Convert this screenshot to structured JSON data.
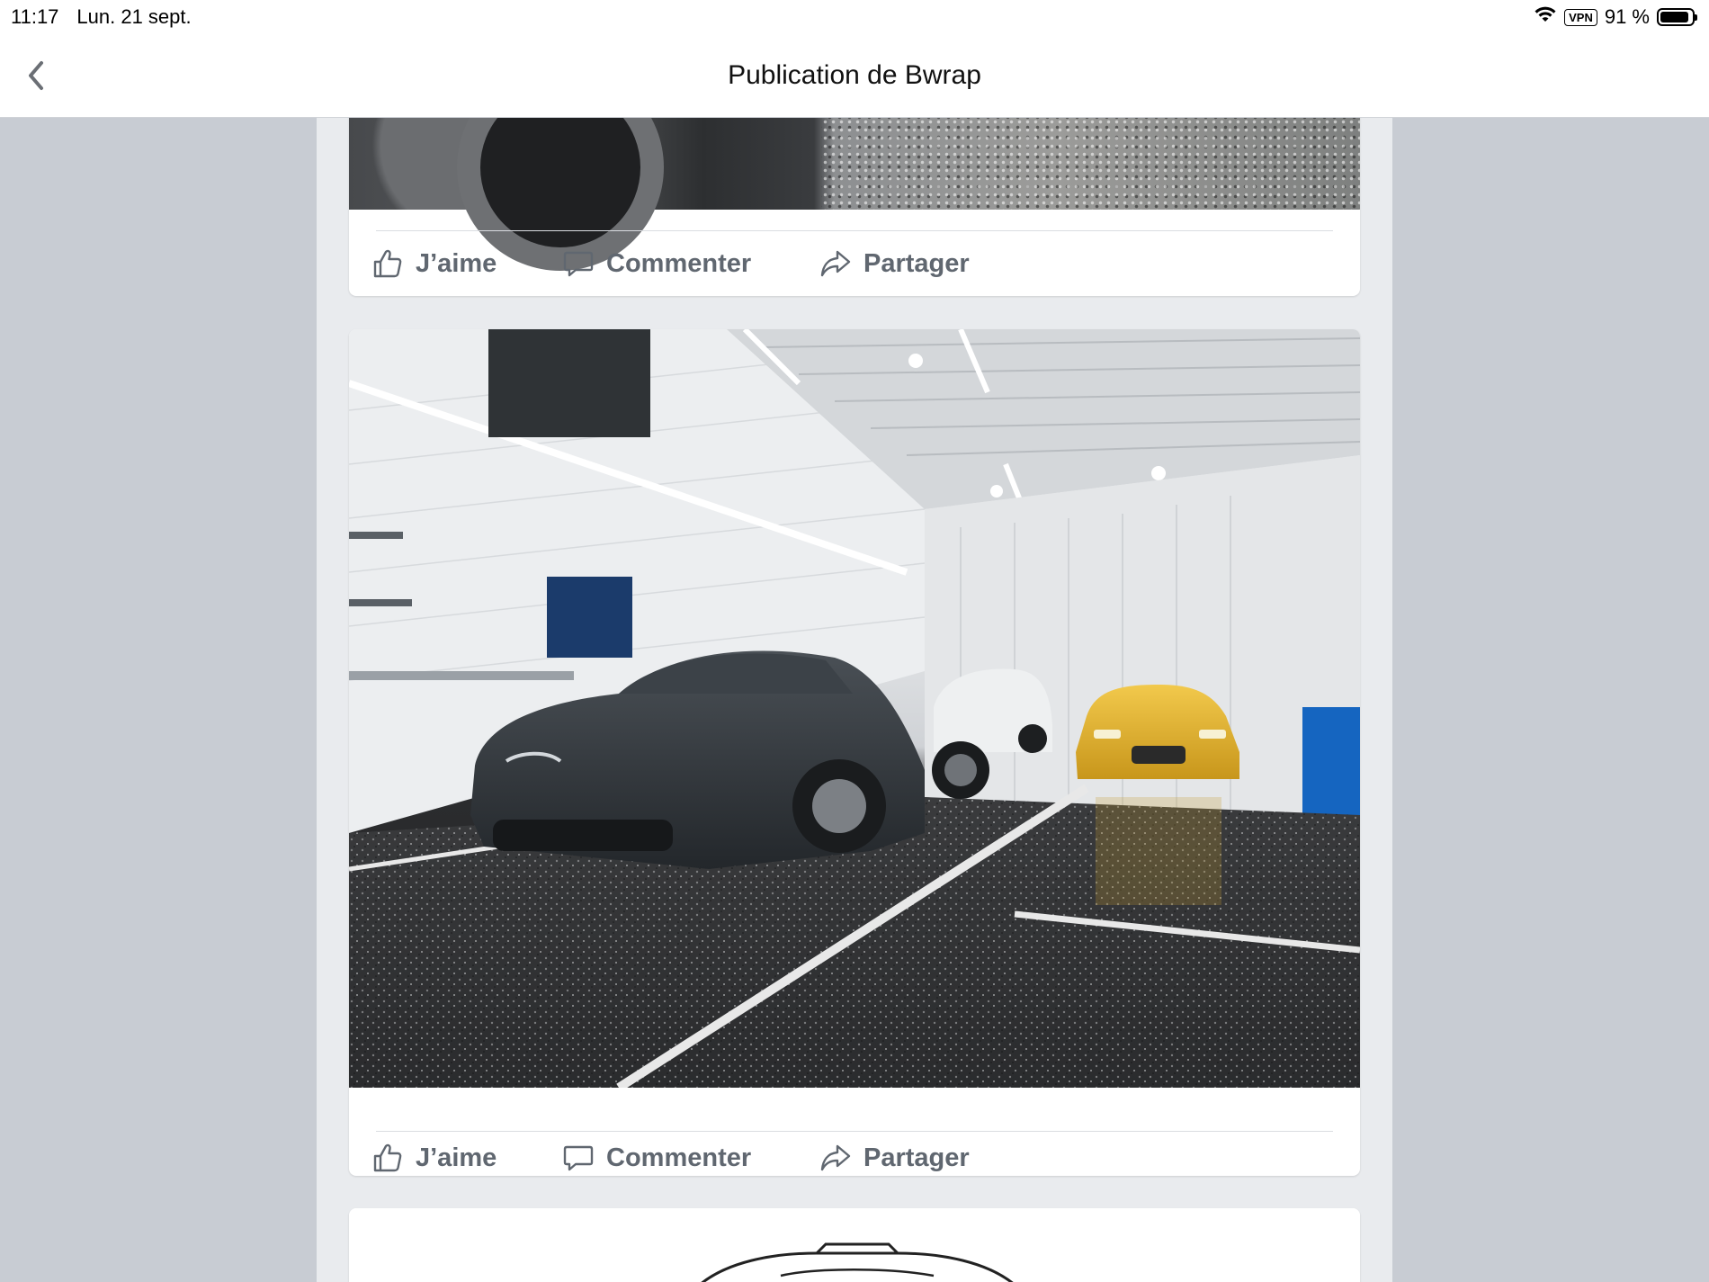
{
  "status_bar": {
    "time": "11:17",
    "date": "Lun. 21 sept.",
    "vpn": "VPN",
    "battery": "91 %",
    "battery_level": 0.91
  },
  "nav": {
    "title": "Publication de Bwrap"
  },
  "posts": [
    {
      "actions": {
        "like": "J’aime",
        "comment": "Commenter",
        "share": "Partager"
      }
    },
    {
      "actions": {
        "like": "J’aime",
        "comment": "Commenter",
        "share": "Partager"
      }
    }
  ],
  "colors": {
    "action_text": "#606770",
    "background": "#e9ebee",
    "side_background": "#c8ccd3",
    "car_yellow": "#e1b72b",
    "car_dark": "#2f3439"
  },
  "icons": [
    "back-chevron-icon",
    "wifi-icon",
    "battery-icon",
    "like-icon",
    "comment-icon",
    "share-icon"
  ]
}
